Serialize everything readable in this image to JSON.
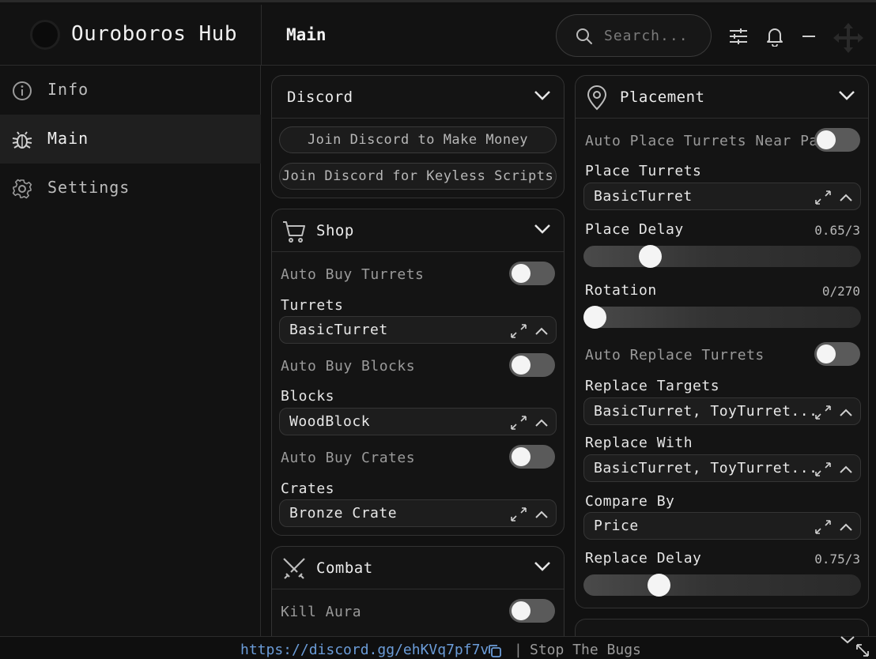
{
  "app": {
    "title": "Ouroboros Hub",
    "page_title": "Main"
  },
  "header": {
    "search_placeholder": "Search..."
  },
  "sidebar": {
    "items": [
      {
        "label": "Info",
        "icon": "info-icon"
      },
      {
        "label": "Main",
        "icon": "bug-icon",
        "active": true
      },
      {
        "label": "Settings",
        "icon": "gear-icon"
      }
    ]
  },
  "discord": {
    "title": "Discord",
    "buttons": [
      "Join Discord to Make Money",
      "Join Discord for Keyless Scripts"
    ]
  },
  "shop": {
    "title": "Shop",
    "auto_buy_turrets": "Auto Buy Turrets",
    "turrets_label": "Turrets",
    "turrets_value": "BasicTurret",
    "auto_buy_blocks": "Auto Buy Blocks",
    "blocks_label": "Blocks",
    "blocks_value": "WoodBlock",
    "auto_buy_crates": "Auto Buy Crates",
    "crates_label": "Crates",
    "crates_value": "Bronze Crate"
  },
  "combat": {
    "title": "Combat",
    "kill_aura": "Kill Aura"
  },
  "placement": {
    "title": "Placement",
    "auto_place": "Auto Place Turrets Near Path",
    "place_turrets_label": "Place Turrets",
    "place_turrets_value": "BasicTurret",
    "place_delay_label": "Place Delay",
    "place_delay_value": "0.65/3",
    "place_delay_fraction": 0.2167,
    "rotation_label": "Rotation",
    "rotation_value": "0/270",
    "rotation_fraction": 0,
    "auto_replace": "Auto Replace Turrets",
    "replace_targets_label": "Replace Targets",
    "replace_targets_value": "BasicTurret, ToyTurret...",
    "replace_with_label": "Replace With",
    "replace_with_value": "BasicTurret, ToyTurret...",
    "compare_by_label": "Compare By",
    "compare_by_value": "Price",
    "replace_delay_label": "Replace Delay",
    "replace_delay_value": "0.75/3",
    "replace_delay_fraction": 0.25
  },
  "footer": {
    "link": "https://discord.gg/ehKVq7pf7v",
    "separator": "|",
    "status": "Stop The Bugs"
  }
}
